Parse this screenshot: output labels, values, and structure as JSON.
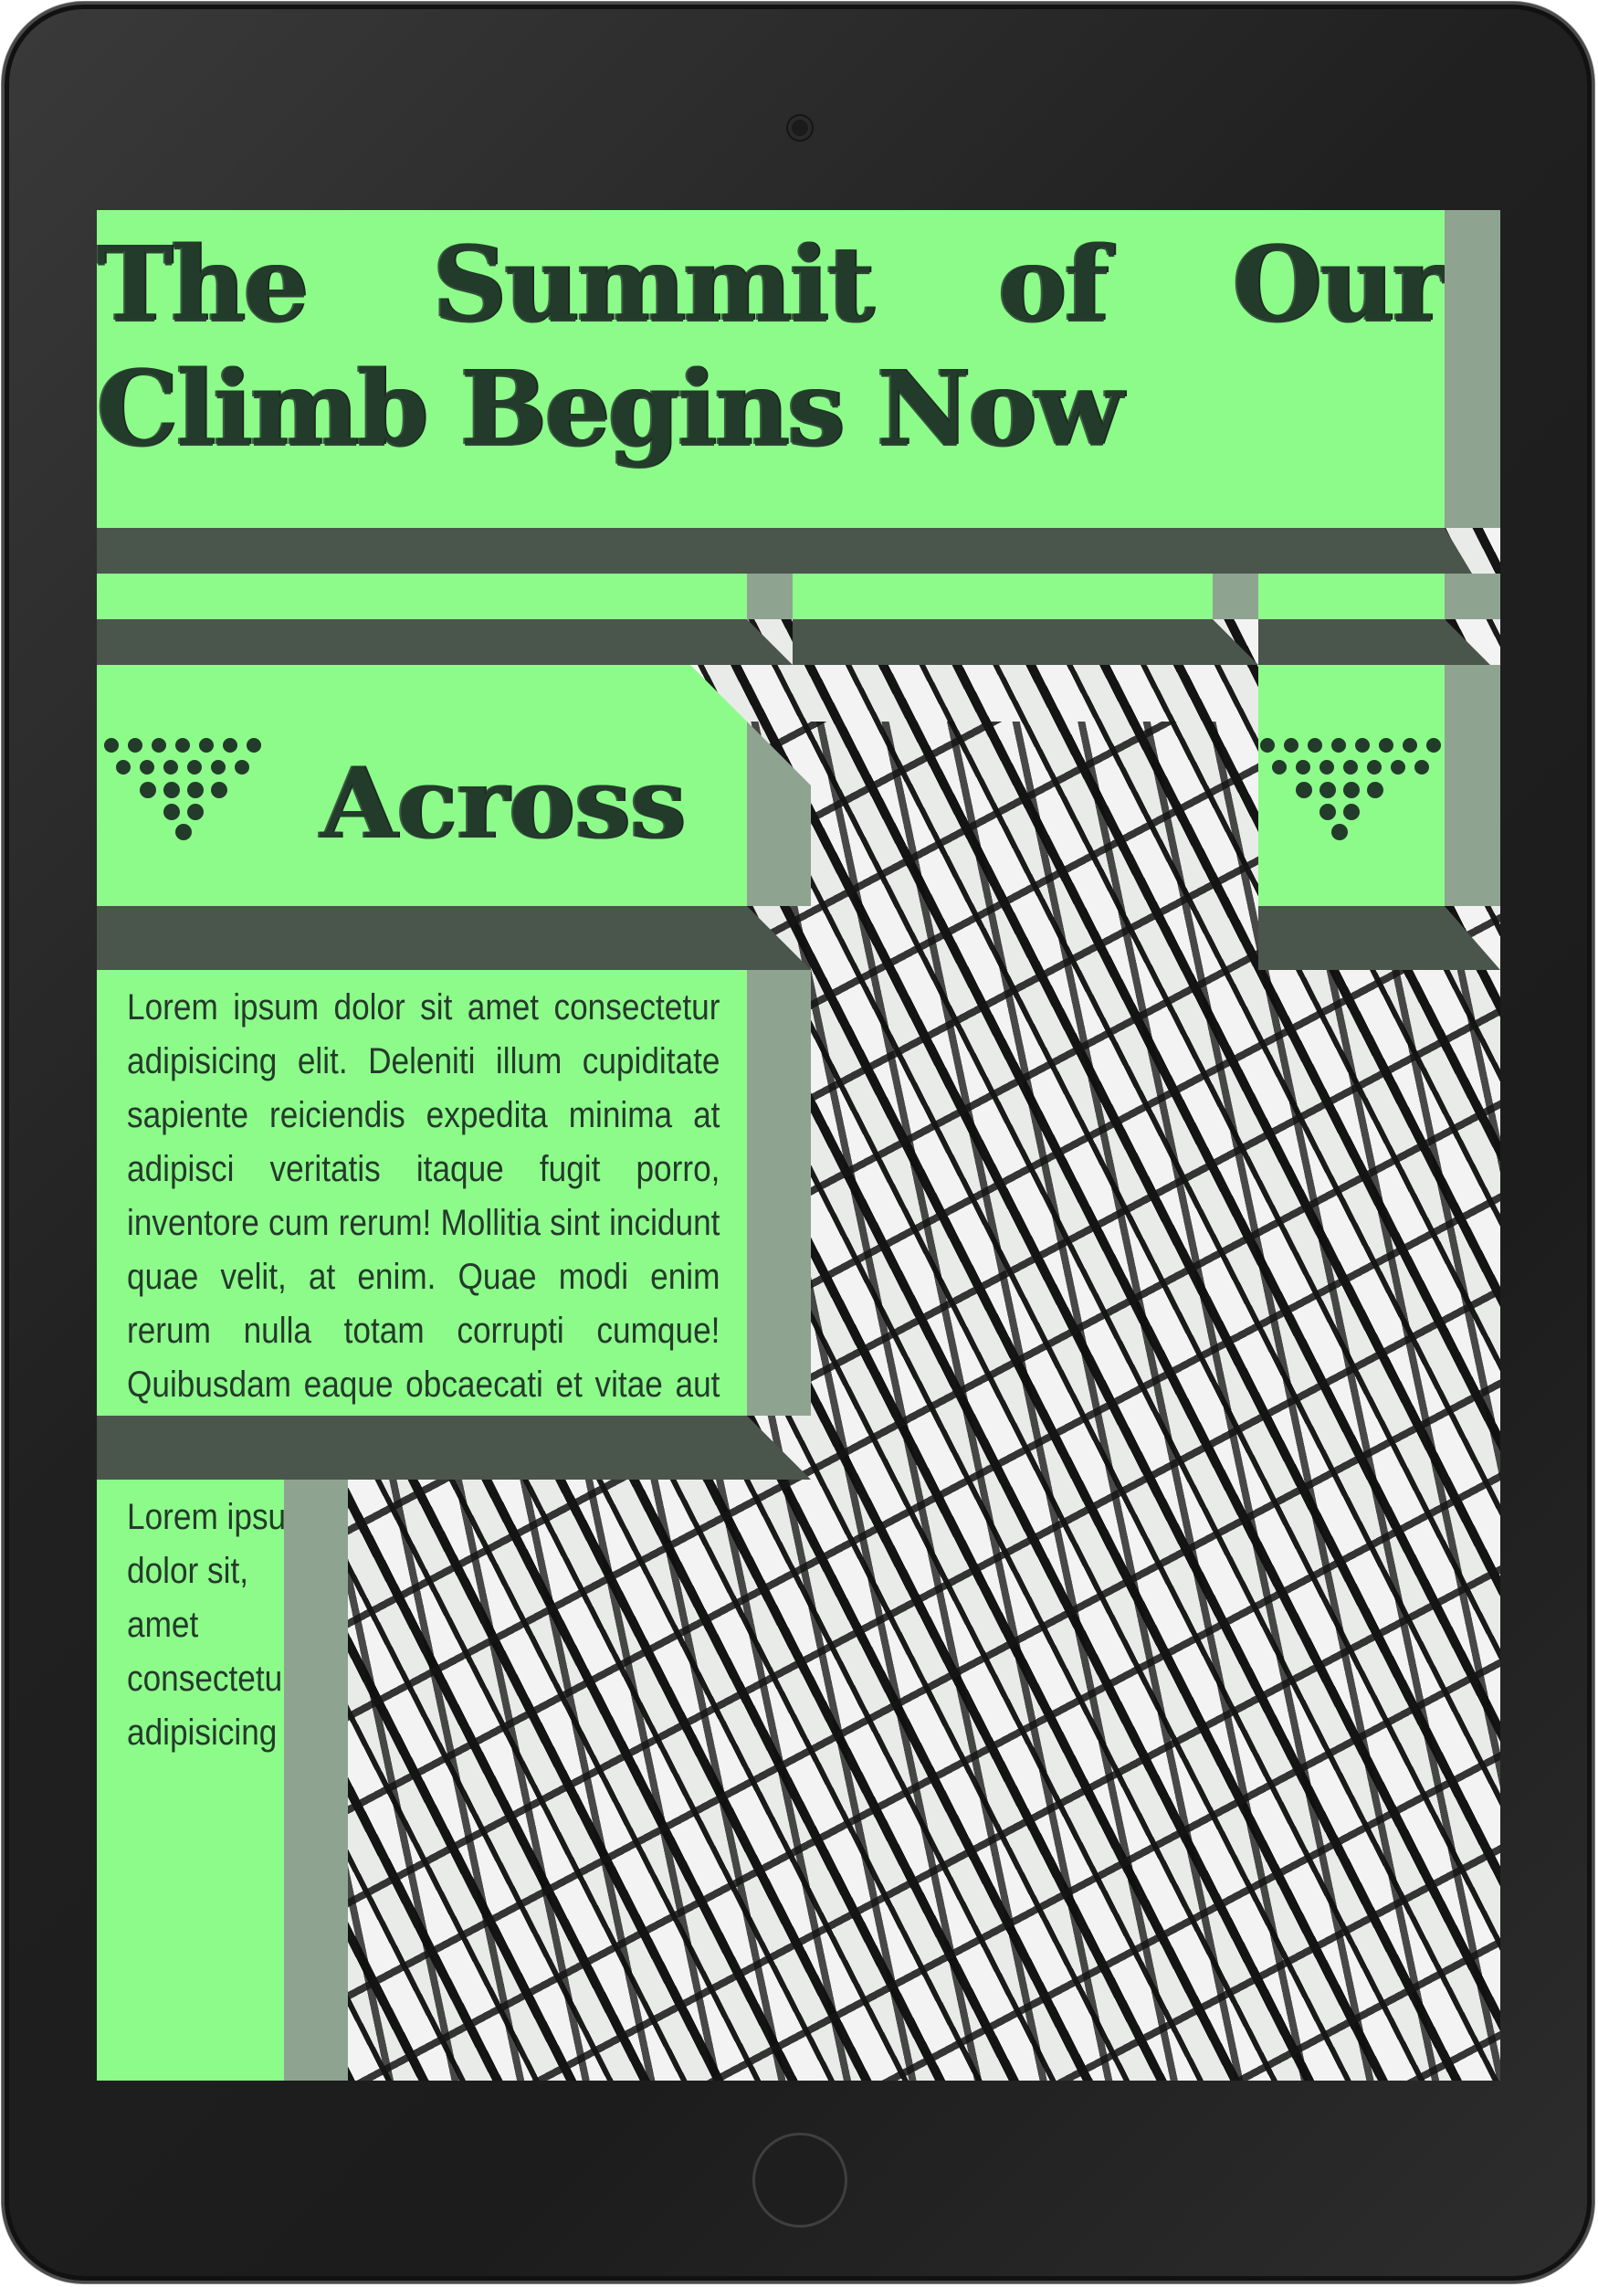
{
  "page": {
    "title": "The Summit of Our Climb Begins Now",
    "section_heading": "Across",
    "paragraph_main": "Lorem ipsum dolor sit amet consectetur adipisicing elit. Deleniti illum cupiditate sapiente reiciendis expedita minima at adipisci veritatis itaque fugit porro, inventore cum rerum! Mollitia sint incidunt quae velit, at enim. Quae modi enim rerum nulla totam corrupti cumque! Quibusdam eaque obcaecati et vitae aut quis neque placeat expedita quaerat.",
    "paragraph_narrow": "Lorem ipsum dolor sit, amet consectetur adipisicing"
  },
  "icons": {
    "left_ornament": "triangle-dots-icon",
    "right_ornament": "triangle-dots-icon",
    "camera": "camera-icon",
    "home": "home-button-icon"
  },
  "colors": {
    "panel_green": "#8cfb8a",
    "panel_side": "#8fa490",
    "panel_shadow": "#4a554c",
    "text_dark": "#233b2a",
    "bezel": "#1e1e1e"
  }
}
